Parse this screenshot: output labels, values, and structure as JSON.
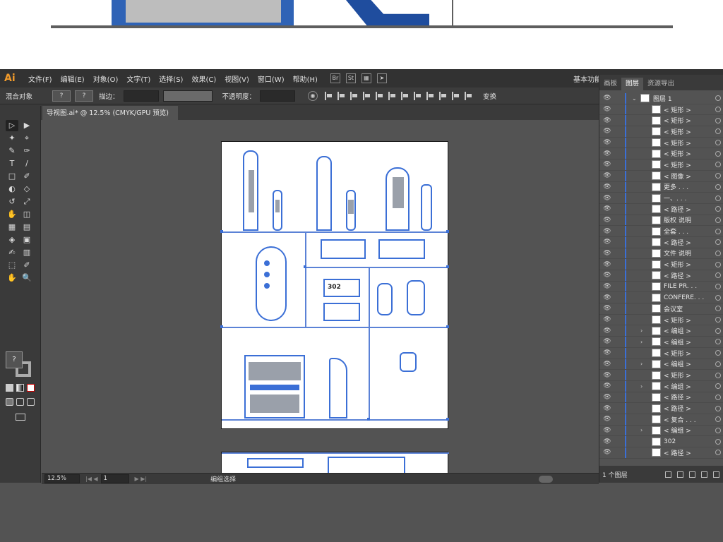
{
  "app": {
    "logo": "Ai",
    "workspace": "基本功能"
  },
  "menu": [
    "文件(F)",
    "编辑(E)",
    "对象(O)",
    "文字(T)",
    "选择(S)",
    "效果(C)",
    "视图(V)",
    "窗口(W)",
    "帮助(H)"
  ],
  "menubar_icons": [
    "Br",
    "St"
  ],
  "control_bar": {
    "mixed_objects": "混合对象",
    "fill_value": "?",
    "stroke_value": "?",
    "stroke_label": "描边：",
    "opacity_label": "不透明度：",
    "transform": "变换"
  },
  "document": {
    "tab_title": "导视图.ai* @ 12.5% (CMYK/GPU 预览)",
    "close": "×"
  },
  "tools": {
    "icons": [
      "▷",
      "▶",
      "✦",
      "⌖",
      "✎",
      "✑",
      "T",
      "/",
      "□",
      "✐",
      "◐",
      "◇",
      "↺",
      "⤢",
      "✋",
      "◫",
      "▦",
      "▤",
      "◈",
      "▣",
      "✍",
      "▥",
      "⬚",
      "✐",
      "✋",
      "🔍"
    ],
    "fill_label": "?"
  },
  "status": {
    "zoom": "12.5%",
    "page": "1",
    "label": "编组选择"
  },
  "canvas": {
    "label_302": "302"
  },
  "panel": {
    "tabs": [
      "画板",
      "图层",
      "资源导出"
    ],
    "active_tab": "图层",
    "top_layer": "图层 1",
    "rows": [
      {
        "name": "< 矩形 >",
        "expand": ""
      },
      {
        "name": "< 矩形 >",
        "expand": ""
      },
      {
        "name": "< 矩形 >",
        "expand": ""
      },
      {
        "name": "< 矩形 >",
        "expand": ""
      },
      {
        "name": "< 矩形 >",
        "expand": ""
      },
      {
        "name": "< 矩形 >",
        "expand": ""
      },
      {
        "name": "< 图像 >",
        "expand": ""
      },
      {
        "name": "更多 . . .",
        "expand": ""
      },
      {
        "name": "一、. . .",
        "expand": ""
      },
      {
        "name": "< 路径 >",
        "expand": ""
      },
      {
        "name": "版权 说明",
        "expand": ""
      },
      {
        "name": "全套 . . .",
        "expand": ""
      },
      {
        "name": "< 路径 >",
        "expand": ""
      },
      {
        "name": "文件 说明",
        "expand": ""
      },
      {
        "name": "< 矩形 >",
        "expand": ""
      },
      {
        "name": "< 路径 >",
        "expand": ""
      },
      {
        "name": "FILE PR. . .",
        "expand": ""
      },
      {
        "name": "CONFERE. . .",
        "expand": ""
      },
      {
        "name": "会议室",
        "expand": ""
      },
      {
        "name": "< 矩形 >",
        "expand": ""
      },
      {
        "name": "< 编组 >",
        "expand": "›"
      },
      {
        "name": "< 编组 >",
        "expand": "›"
      },
      {
        "name": "< 矩形 >",
        "expand": ""
      },
      {
        "name": "< 编组 >",
        "expand": "›"
      },
      {
        "name": "< 矩形 >",
        "expand": ""
      },
      {
        "name": "< 编组 >",
        "expand": "›"
      },
      {
        "name": "< 路径 >",
        "expand": ""
      },
      {
        "name": "< 路径 >",
        "expand": ""
      },
      {
        "name": "< 复合 . . .",
        "expand": ""
      },
      {
        "name": "< 编组 >",
        "expand": "›"
      },
      {
        "name": "302",
        "expand": ""
      },
      {
        "name": "< 路径 >",
        "expand": ""
      }
    ],
    "footer": "1 个图层"
  },
  "colors": {
    "accent": "#3b6fd6",
    "panel_bg": "#535353",
    "dark_bg": "#323232"
  }
}
